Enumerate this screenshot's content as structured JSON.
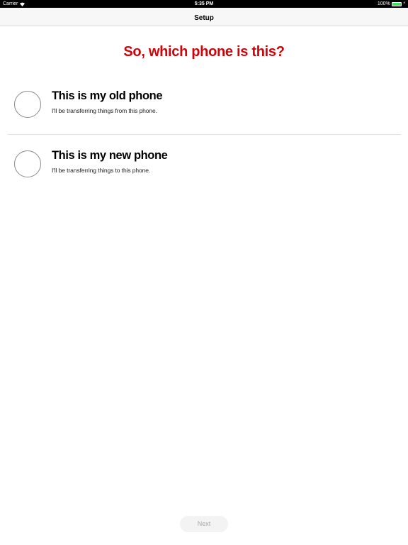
{
  "status_bar": {
    "carrier": "Carrier",
    "wifi_icon": "wifi-icon",
    "time": "5:35 PM",
    "battery_percent": "100%",
    "battery_level": 1.0,
    "battery_color": "#4cd964",
    "charging_icon": "charging-bolt-icon"
  },
  "nav": {
    "title": "Setup"
  },
  "main": {
    "headline": "So, which phone is this?",
    "headline_color": "#cd040b",
    "options": [
      {
        "title": "This is my old phone",
        "subtitle": "I'll be transferring things from this phone.",
        "selected": false
      },
      {
        "title": "This is my new phone",
        "subtitle": "I'll be transferring things to this phone.",
        "selected": false
      }
    ]
  },
  "footer": {
    "next_label": "Next",
    "next_enabled": false
  }
}
